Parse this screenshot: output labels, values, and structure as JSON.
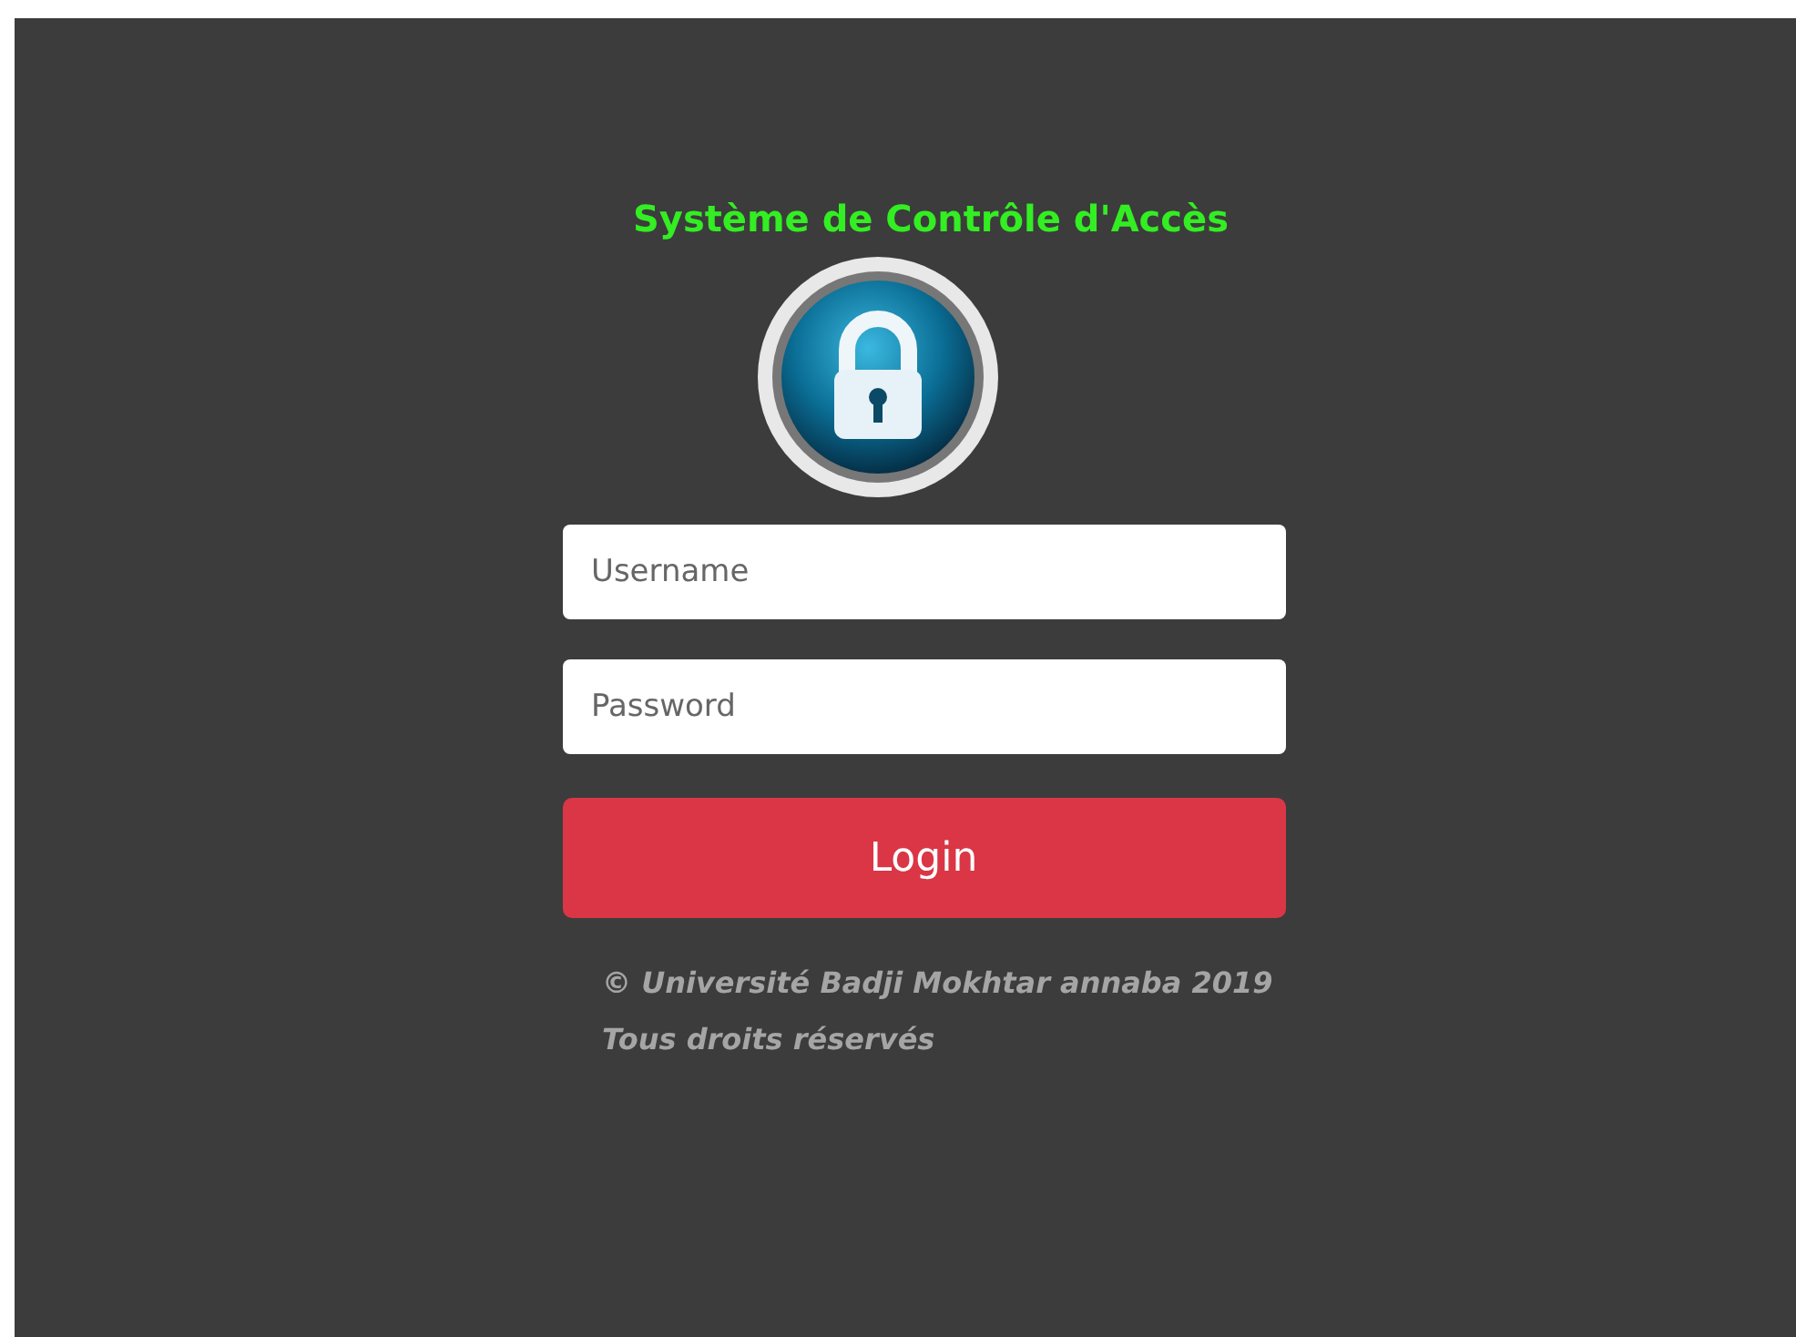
{
  "title": "Système de Contrôle d'Accès",
  "username_field": {
    "placeholder": "Username"
  },
  "password_field": {
    "placeholder": "Password"
  },
  "login_button": "Login",
  "footer": [
    "© Université Badji Mokhtar annaba 2019",
    "Tous droits réservés"
  ]
}
